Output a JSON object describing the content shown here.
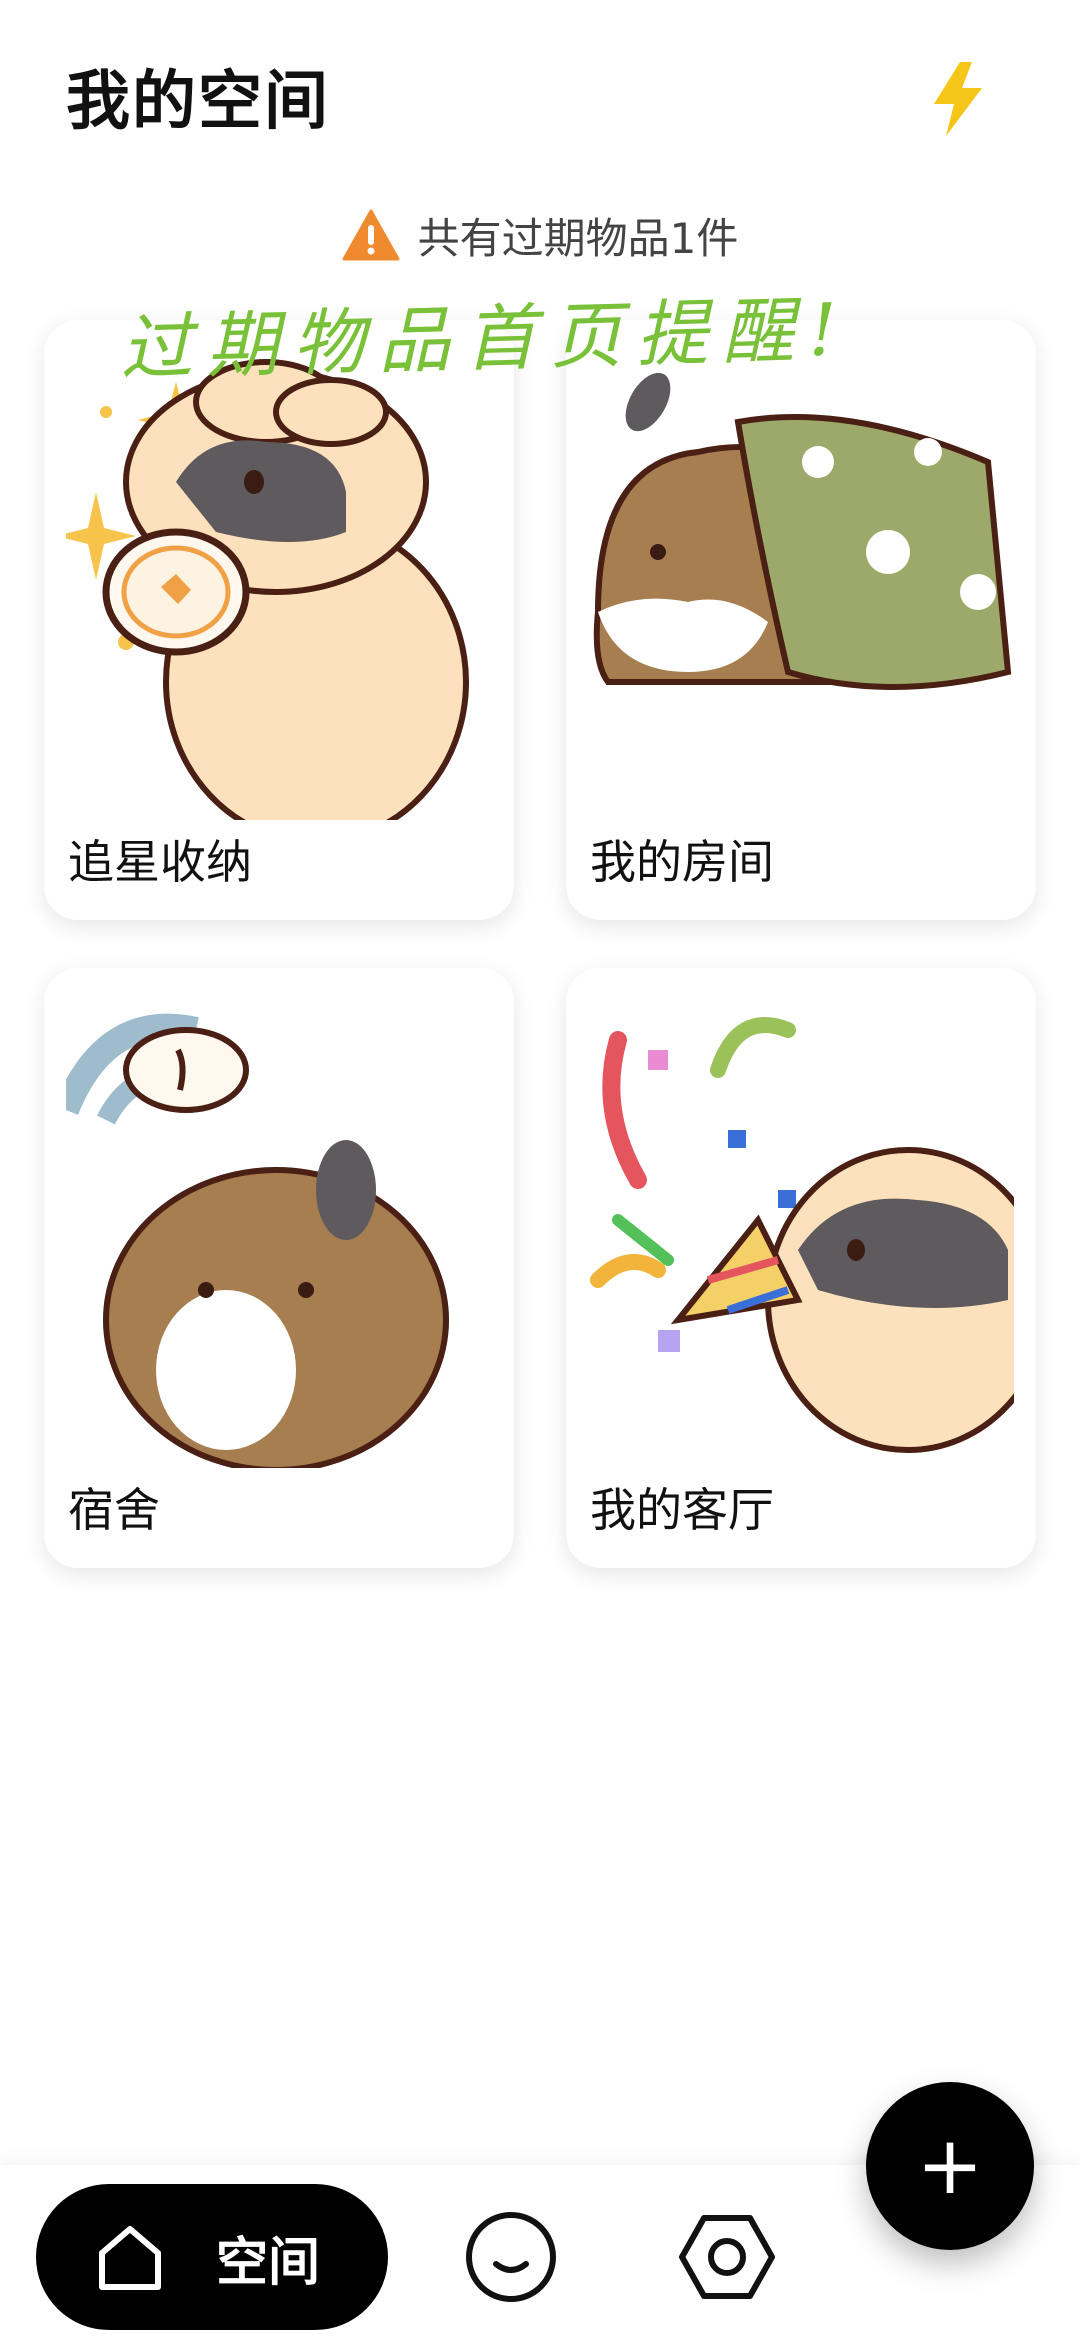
{
  "header": {
    "title": "我的空间",
    "bolt_icon": "lightning-bolt-icon",
    "accent_color": "#f5c518"
  },
  "notice": {
    "text": "共有过期物品1件",
    "icon": "warning-triangle-icon",
    "icon_color": "#f08a2e"
  },
  "annotation": {
    "text": "过期物品首页提醒!",
    "color": "#7ac13a"
  },
  "cards": [
    {
      "label": "追星收纳",
      "art": "bunny-with-mirror-illustration"
    },
    {
      "label": "我的房间",
      "art": "bunny-under-blanket-illustration"
    },
    {
      "label": "宿舍",
      "art": "bunny-with-wifi-illustration"
    },
    {
      "label": "我的客厅",
      "art": "bunny-party-popper-illustration"
    }
  ],
  "fab": {
    "icon": "plus-icon",
    "symbol": "+"
  },
  "bottom_nav": {
    "home_label": "空间",
    "items": [
      {
        "icon": "home-icon",
        "active": true
      },
      {
        "icon": "smile-face-icon",
        "active": false
      },
      {
        "icon": "settings-hexagon-icon",
        "active": false
      }
    ]
  }
}
